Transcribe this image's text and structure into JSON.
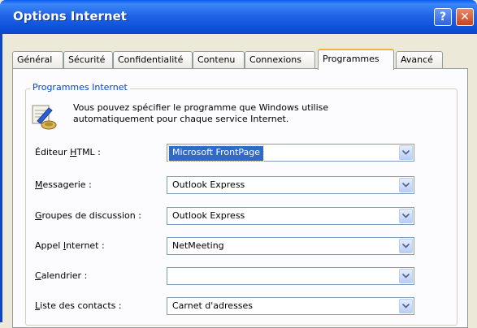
{
  "window": {
    "title": "Options Internet",
    "help_glyph": "?",
    "close_glyph": "✕"
  },
  "tabs": [
    {
      "label": "Général"
    },
    {
      "label": "Sécurité"
    },
    {
      "label": "Confidentialité"
    },
    {
      "label": "Contenu"
    },
    {
      "label": "Connexions"
    },
    {
      "label": "Programmes",
      "active": true
    },
    {
      "label": "Avancé"
    }
  ],
  "group": {
    "title": "Programmes Internet",
    "description_line1": "Vous pouvez spécifier le programme que Windows utilise",
    "description_line2": "automatiquement pour chaque service Internet.",
    "icon": "programs-settings-icon"
  },
  "fields": [
    {
      "label_pre": "Éditeur ",
      "label_u": "H",
      "label_post": "TML :",
      "value": "Microsoft FrontPage",
      "selected": true
    },
    {
      "label_pre": "",
      "label_u": "M",
      "label_post": "essagerie :",
      "value": "Outlook Express"
    },
    {
      "label_pre": "",
      "label_u": "G",
      "label_post": "roupes de discussion :",
      "value": "Outlook Express"
    },
    {
      "label_pre": "Appel ",
      "label_u": "I",
      "label_post": "nternet :",
      "value": "NetMeeting"
    },
    {
      "label_pre": "",
      "label_u": "C",
      "label_post": "alendrier :",
      "value": ""
    },
    {
      "label_pre": "",
      "label_u": "L",
      "label_post": "iste des contacts :",
      "value": "Carnet d'adresses"
    }
  ],
  "colors": {
    "titlebar": "#0b46c6",
    "accent_tab": "#f2b33d",
    "selection": "#316ac5",
    "group_title": "#0046d5"
  }
}
